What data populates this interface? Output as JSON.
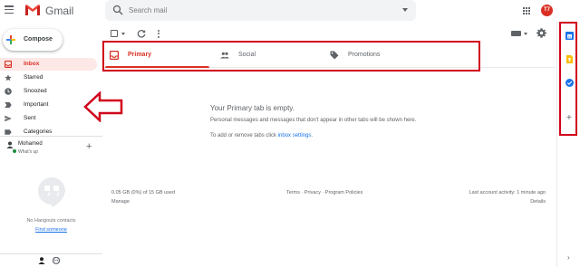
{
  "header": {
    "logo_text": "Gmail",
    "search_placeholder": "Search mail",
    "avatar_initials": "T7"
  },
  "compose": {
    "label": "Compose"
  },
  "sidebar": {
    "items": [
      {
        "label": "Inbox",
        "icon": "inbox-icon",
        "active": true
      },
      {
        "label": "Starred",
        "icon": "star-icon"
      },
      {
        "label": "Snoozed",
        "icon": "clock-icon"
      },
      {
        "label": "Important",
        "icon": "label-important-icon"
      },
      {
        "label": "Sent",
        "icon": "send-icon"
      },
      {
        "label": "Categories",
        "icon": "label-icon"
      }
    ]
  },
  "hangouts": {
    "user_name": "Mohamed",
    "user_status": "What's up",
    "no_contacts": "No Hangouts contacts",
    "find_someone": "Find someone"
  },
  "tabs": [
    {
      "label": "Primary",
      "icon": "inbox-tab-icon",
      "active": true
    },
    {
      "label": "Social",
      "icon": "people-icon"
    },
    {
      "label": "Promotions",
      "icon": "tag-icon"
    }
  ],
  "empty": {
    "title": "Your Primary tab is empty.",
    "description": "Personal messages and messages that don't appear in other tabs will be shown here.",
    "hint_prefix": "To add or remove tabs click ",
    "hint_link": "inbox settings",
    "hint_suffix": "."
  },
  "footer": {
    "storage": "0.05 GB (0%) of 15 GB used",
    "manage": "Manage",
    "terms": "Terms · Privacy · Program Policies",
    "activity": "Last account activity: 1 minute ago",
    "details": "Details"
  },
  "colors": {
    "accent_red": "#d93025",
    "annotation_red": "#d0021b",
    "link_blue": "#1a73e8"
  }
}
